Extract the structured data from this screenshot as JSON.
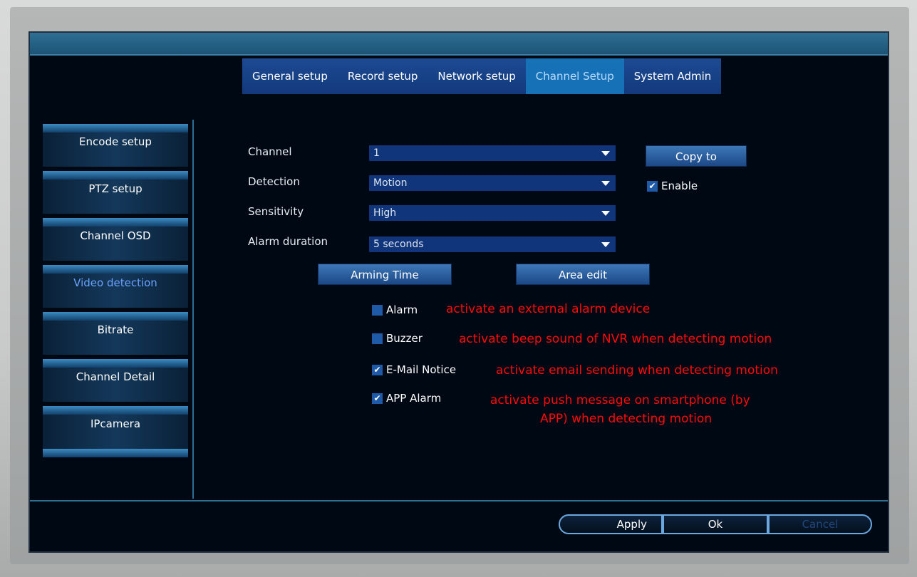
{
  "tabs": [
    {
      "label": "General setup"
    },
    {
      "label": "Record setup"
    },
    {
      "label": "Network setup"
    },
    {
      "label": "Channel Setup"
    },
    {
      "label": "System Admin"
    }
  ],
  "sidebar": [
    {
      "label": "Encode setup"
    },
    {
      "label": "PTZ setup"
    },
    {
      "label": "Channel OSD"
    },
    {
      "label": "Video detection"
    },
    {
      "label": "Bitrate"
    },
    {
      "label": "Channel Detail"
    },
    {
      "label": "IPcamera"
    }
  ],
  "form": {
    "channel_label": "Channel",
    "channel_value": "1",
    "detection_label": "Detection",
    "detection_value": "Motion",
    "sensitivity_label": "Sensitivity",
    "sensitivity_value": "High",
    "alarm_duration_label": "Alarm duration",
    "alarm_duration_value": "5 seconds",
    "copy_to": "Copy to",
    "enable": "Enable",
    "arming_time": "Arming Time",
    "area_edit": "Area edit"
  },
  "actions": {
    "alarm": "Alarm",
    "buzzer": "Buzzer",
    "email": "E-Mail Notice",
    "app": "APP Alarm"
  },
  "notes": {
    "alarm": "activate an external alarm device",
    "buzzer": "activate beep sound of NVR when detecting motion",
    "email": "activate email sending when detecting motion",
    "app_line1": "activate push message on smartphone (by",
    "app_line2": "APP) when detecting motion"
  },
  "footer": {
    "apply": "Apply",
    "ok": "Ok",
    "cancel": "Cancel"
  }
}
